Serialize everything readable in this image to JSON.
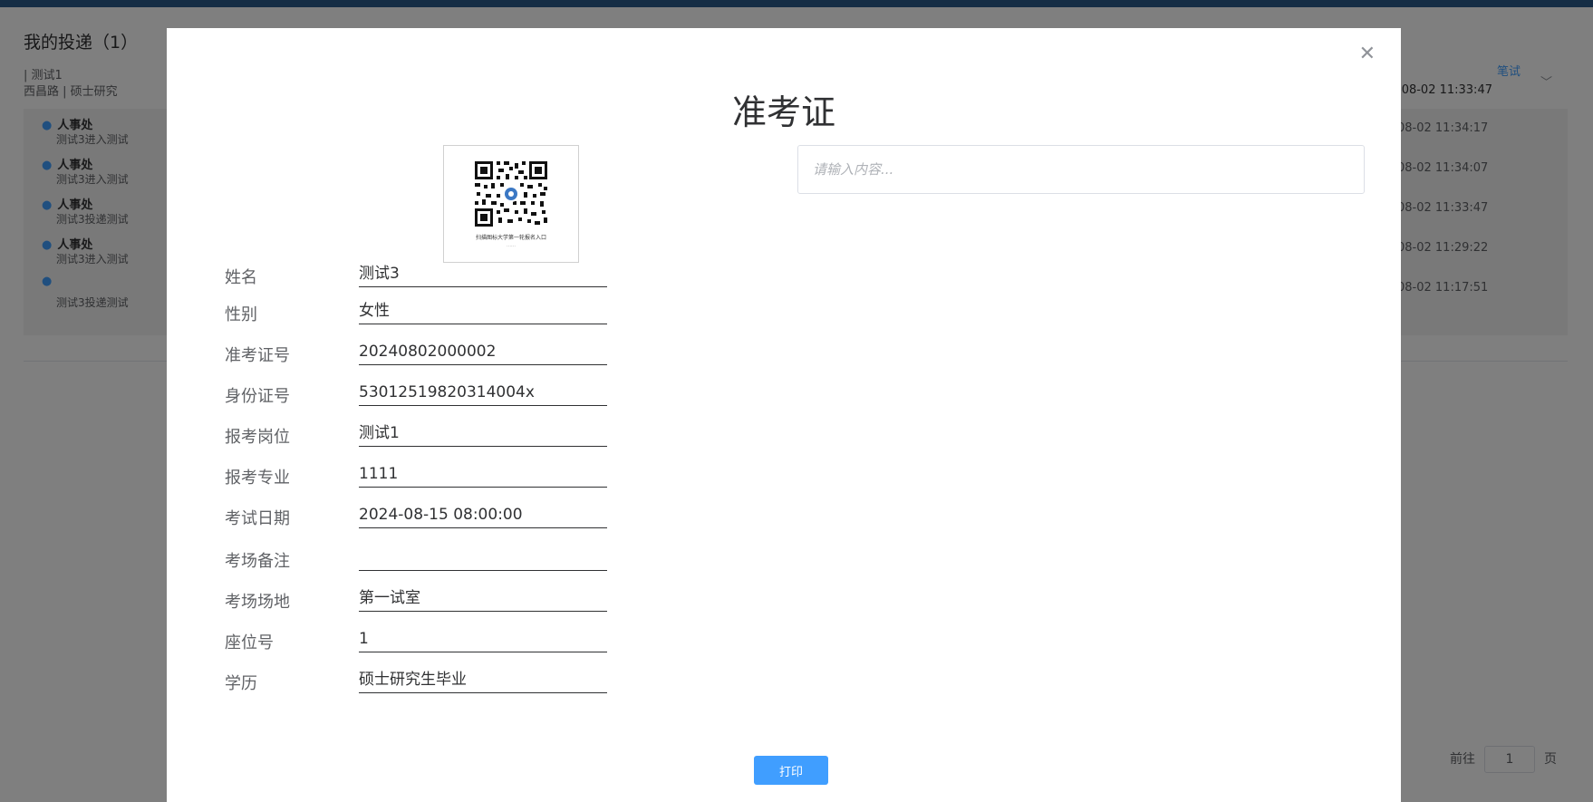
{
  "background": {
    "page_title": "我的投递（1）",
    "job_line1": "| 测试1",
    "job_line2": "西昌路 | 硕士研究",
    "stage_label": "笔试",
    "stage_time": "-08-02 11:33:47",
    "timeline": [
      {
        "org": "人事处",
        "desc": "测试3进入测试",
        "time": "08-02 11:34:17"
      },
      {
        "org": "人事处",
        "desc": "测试3进入测试",
        "time": "08-02 11:34:07"
      },
      {
        "org": "人事处",
        "desc": "测试3投递测试",
        "time": "08-02 11:33:47"
      },
      {
        "org": "人事处",
        "desc": "测试3进入测试",
        "time": "08-02 11:29:22"
      },
      {
        "org": "",
        "desc": "测试3投递测试",
        "time": "08-02 11:17:51"
      }
    ],
    "pager": {
      "goto_label": "前往",
      "page": "1",
      "page_suffix": "页"
    }
  },
  "modal": {
    "title": "准考证",
    "close_icon": "close-icon",
    "qr_caption": "扫描图标大学第一轮报名入口",
    "qr_caption2": "……",
    "remark_placeholder": "请输入内容...",
    "fields": [
      {
        "label": "姓名",
        "value": "测试3"
      },
      {
        "label": "性别",
        "value": "女性"
      },
      {
        "label": "准考证号",
        "value": "20240802000002"
      },
      {
        "label": "身份证号",
        "value": "53012519820314004x"
      },
      {
        "label": "报考岗位",
        "value": "测试1"
      },
      {
        "label": "报考专业",
        "value": "1111"
      },
      {
        "label": "考试日期",
        "value": "2024-08-15 08:00:00"
      },
      {
        "label": "考场备注",
        "value": ""
      },
      {
        "label": "考场场地",
        "value": "第一试室"
      },
      {
        "label": "座位号",
        "value": "1"
      },
      {
        "label": "学历",
        "value": "硕士研究生毕业"
      }
    ],
    "print_label": "打印"
  },
  "colors": {
    "primary": "#409eff",
    "topbar": "#2b5b8a",
    "overlay": "rgba(0,0,0,0.5)"
  }
}
